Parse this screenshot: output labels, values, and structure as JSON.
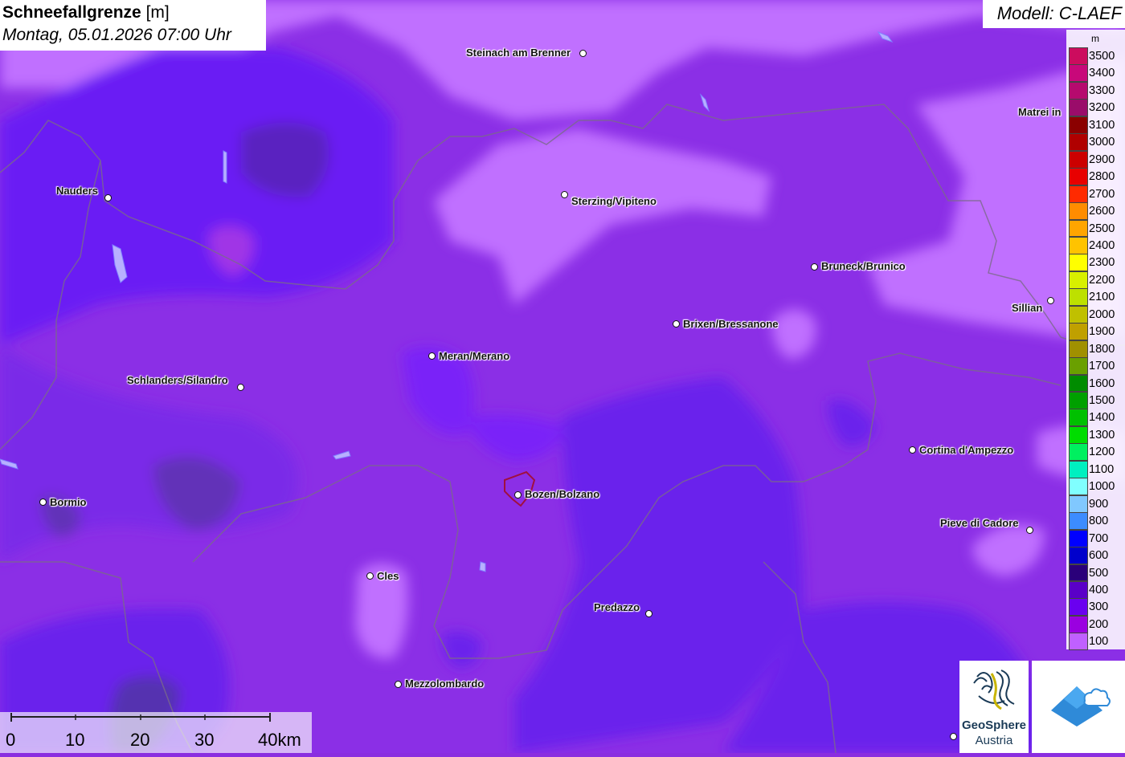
{
  "title": {
    "main": "Schneefallgrenze",
    "unit": "[m]",
    "datetime": "Montag, 05.01.2026 07:00 Uhr"
  },
  "model": "Modell: C-LAEF",
  "legend": {
    "unit": "m",
    "entries": [
      {
        "label": "3500",
        "color": "#cc0c5e"
      },
      {
        "label": "3400",
        "color": "#c8087a"
      },
      {
        "label": "3300",
        "color": "#b60a6e"
      },
      {
        "label": "3200",
        "color": "#9a0c6a"
      },
      {
        "label": "3100",
        "color": "#8b0000"
      },
      {
        "label": "3000",
        "color": "#b00000"
      },
      {
        "label": "2900",
        "color": "#cc0000"
      },
      {
        "label": "2800",
        "color": "#e80000"
      },
      {
        "label": "2700",
        "color": "#ff2a00"
      },
      {
        "label": "2600",
        "color": "#ff8c00"
      },
      {
        "label": "2500",
        "color": "#ffa500"
      },
      {
        "label": "2400",
        "color": "#ffc300"
      },
      {
        "label": "2300",
        "color": "#ffff00"
      },
      {
        "label": "2200",
        "color": "#d8f000"
      },
      {
        "label": "2100",
        "color": "#bde000"
      },
      {
        "label": "2000",
        "color": "#c0c000"
      },
      {
        "label": "1900",
        "color": "#c0a000"
      },
      {
        "label": "1800",
        "color": "#a09000"
      },
      {
        "label": "1700",
        "color": "#6aa000"
      },
      {
        "label": "1600",
        "color": "#008c00"
      },
      {
        "label": "1500",
        "color": "#00a000"
      },
      {
        "label": "1400",
        "color": "#00c000"
      },
      {
        "label": "1300",
        "color": "#00dd00"
      },
      {
        "label": "1200",
        "color": "#00f060"
      },
      {
        "label": "1100",
        "color": "#00f0c0"
      },
      {
        "label": "1000",
        "color": "#80ffff"
      },
      {
        "label": "900",
        "color": "#80c8ff"
      },
      {
        "label": "800",
        "color": "#3c8cff"
      },
      {
        "label": "700",
        "color": "#0000ff"
      },
      {
        "label": "600",
        "color": "#0000cc"
      },
      {
        "label": "500",
        "color": "#2a007a"
      },
      {
        "label": "400",
        "color": "#5a00c8"
      },
      {
        "label": "300",
        "color": "#6a00f0"
      },
      {
        "label": "200",
        "color": "#9a00e0"
      },
      {
        "label": "100",
        "color": "#c060ff"
      }
    ]
  },
  "cities": [
    {
      "name": "Steinach am Brenner"
    },
    {
      "name": "Matrei in"
    },
    {
      "name": "Nauders"
    },
    {
      "name": "Sterzing/Vipiteno"
    },
    {
      "name": "Bruneck/Brunico"
    },
    {
      "name": "Sillian"
    },
    {
      "name": "Brixen/Bressanone"
    },
    {
      "name": "Meran/Merano"
    },
    {
      "name": "Schlanders/Silandro"
    },
    {
      "name": "Cortina d'Ampezzo"
    },
    {
      "name": "Bormio"
    },
    {
      "name": "Bozen/Bolzano"
    },
    {
      "name": "Pieve di Cadore"
    },
    {
      "name": "Cles"
    },
    {
      "name": "Predazzo"
    },
    {
      "name": "Mezzolombardo"
    }
  ],
  "scale": {
    "labels": [
      "0",
      "10",
      "20",
      "30",
      "40km"
    ]
  },
  "logos": {
    "geosphere_line1": "GeoSphere",
    "geosphere_line2": "Austria"
  }
}
